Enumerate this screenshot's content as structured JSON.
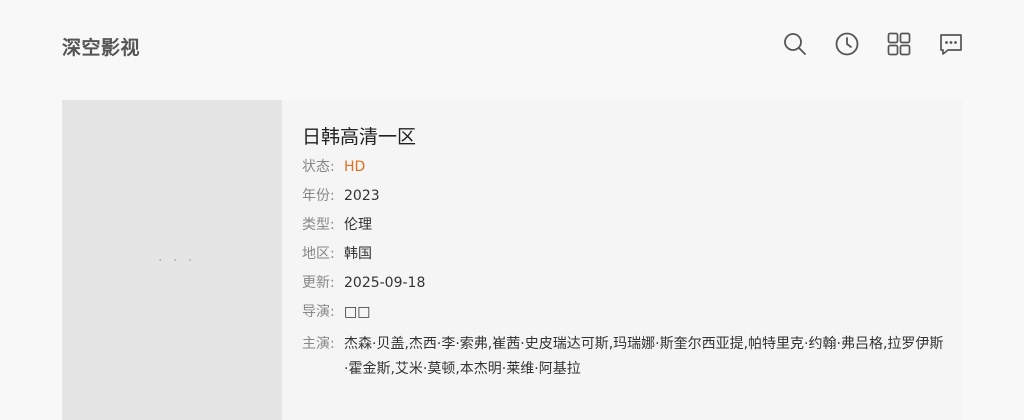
{
  "header": {
    "logo": "深空影视",
    "icons": [
      "search-icon",
      "history-icon",
      "grid-menu-icon",
      "message-icon"
    ]
  },
  "detail": {
    "title": "日韩高清一区",
    "poster_placeholder": "· · ·",
    "fields": {
      "status": {
        "label": "状态:",
        "value": "HD",
        "color": "#e0701e"
      },
      "year": {
        "label": "年份:",
        "value": "2023"
      },
      "genre": {
        "label": "类型:",
        "value": "伦理"
      },
      "region": {
        "label": "地区:",
        "value": "韩国"
      },
      "updated": {
        "label": "更新:",
        "value": "2025-09-18"
      },
      "director": {
        "label": "导演:",
        "value": "□□"
      },
      "cast": {
        "label": "主演:",
        "value": "杰森·贝盖,杰西·李·索弗,崔茜·史皮瑞达可斯,玛瑞娜·斯奎尔西亚提,帕特里克·约翰·弗吕格,拉罗伊斯·霍金斯,艾米·莫顿,本杰明·莱维·阿基拉"
      }
    }
  }
}
